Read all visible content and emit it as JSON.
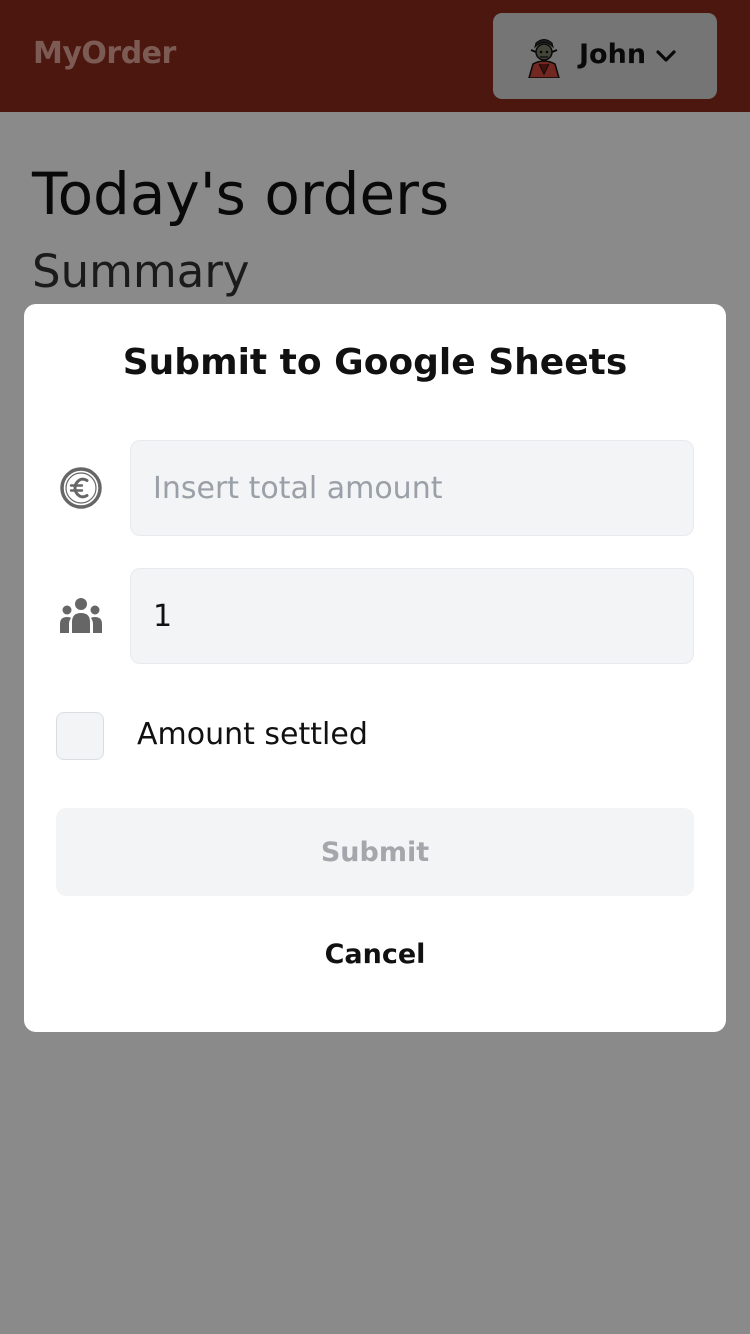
{
  "header": {
    "brand": "MyOrder",
    "user": {
      "name": "John"
    }
  },
  "main": {
    "title": "Today's orders",
    "section_title": "Summary"
  },
  "modal": {
    "title": "Submit to Google Sheets",
    "amount_field": {
      "value": "",
      "placeholder": "Insert total amount"
    },
    "people_field": {
      "value": "1"
    },
    "settled_checkbox": {
      "label": "Amount settled",
      "checked": false
    },
    "submit_label": "Submit",
    "cancel_label": "Cancel"
  },
  "icons": {
    "avatar": "avatar-icon",
    "chevron": "chevron-down-icon",
    "currency": "euro-icon",
    "people": "people-icon"
  },
  "colors": {
    "header_bg": "#8c2c1b",
    "brand_text": "#e6a99e",
    "overlay": "rgba(0,0,0,0.46)",
    "field_bg": "#f3f4f6",
    "disabled_text": "#a3a6ab"
  }
}
